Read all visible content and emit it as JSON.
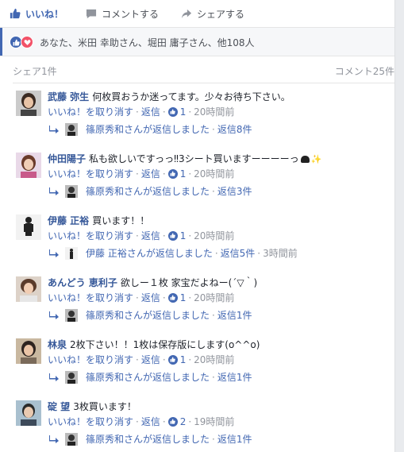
{
  "actions": {
    "like": "いいね！",
    "comment": "コメントする",
    "share": "シェアする"
  },
  "summary": {
    "names": "あなた、米田 幸助さん、堀田 庸子さん、他108人"
  },
  "meta": {
    "shares": "シェア1件",
    "comments": "コメント25件"
  },
  "comments": [
    {
      "name": "武藤 弥生",
      "text": "何枚買おうか迷ってます。少々お待ち下さい。",
      "unlike": "いいね！を取り消す",
      "reply": "返信",
      "likes": "1",
      "time": "20時間前",
      "reply_summary": "篠原秀和さんが返信しました",
      "reply_count": "返信8件"
    },
    {
      "name": "仲田陽子",
      "text": "私も欲しいですっっ‼3シート買いますーーーーっ",
      "unlike": "いいね！を取り消す",
      "reply": "返信",
      "likes": "1",
      "time": "20時間前",
      "reply_summary": "篠原秀和さんが返信しました",
      "reply_count": "返信3件"
    },
    {
      "name": "伊藤 正裕",
      "text": "買います！！",
      "unlike": "いいね！を取り消す",
      "reply": "返信",
      "likes": "1",
      "time": "20時間前",
      "reply_summary": "伊藤 正裕さんが返信しました",
      "reply_count": "返信5件",
      "reply_time": "3時間前"
    },
    {
      "name": "あんどう 恵利子",
      "text": "欲しー１枚 家宝だよねー(´▽｀)",
      "unlike": "いいね！を取り消す",
      "reply": "返信",
      "likes": "1",
      "time": "20時間前",
      "reply_summary": "篠原秀和さんが返信しました",
      "reply_count": "返信1件"
    },
    {
      "name": "林泉",
      "text": "2枚下さい！！1枚は保存版にします(o^^o)",
      "unlike": "いいね！を取り消す",
      "reply": "返信",
      "likes": "1",
      "time": "20時間前",
      "reply_summary": "篠原秀和さんが返信しました",
      "reply_count": "返信1件"
    },
    {
      "name": "碇 望",
      "text": "3枚買います！",
      "unlike": "いいね！を取り消す",
      "reply": "返信",
      "likes": "2",
      "time": "19時間前",
      "reply_summary": "篠原秀和さんが返信しました",
      "reply_count": "返信1件"
    }
  ],
  "colors": {
    "link": "#4267b2",
    "name": "#365899",
    "meta": "#90949c",
    "love": "#f25268"
  }
}
